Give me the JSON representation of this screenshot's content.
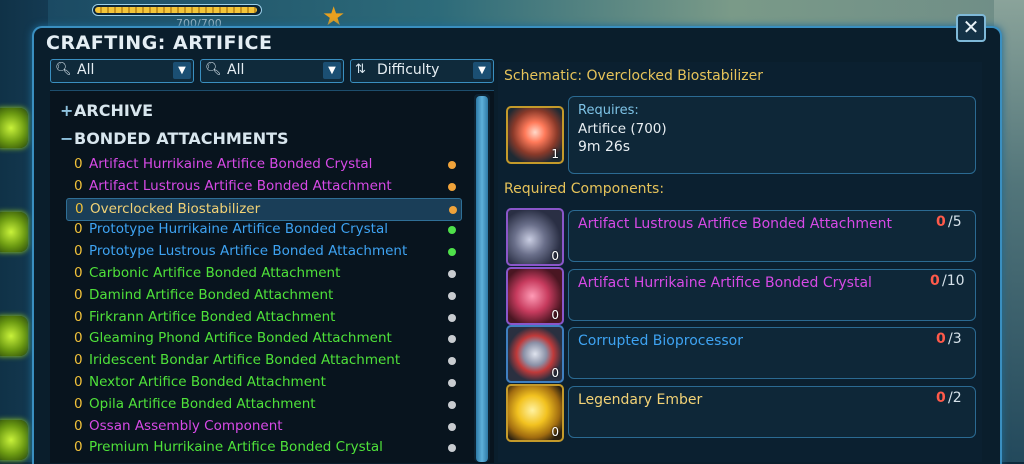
{
  "window": {
    "title": "CRAFTING: ARTIFICE"
  },
  "background": {
    "resource_bar_value": "700/700",
    "progress": 1.0
  },
  "filters": [
    {
      "label": "All",
      "icon": "search-icon"
    },
    {
      "label": "All",
      "icon": "search-icon"
    },
    {
      "label": "Difficulty",
      "icon": "sort-icon"
    }
  ],
  "categories": [
    {
      "symbol": "+",
      "label": "ARCHIVE"
    },
    {
      "symbol": "−",
      "label": "BONDED ATTACHMENTS"
    }
  ],
  "recipes": [
    {
      "count": "0",
      "name": "Artifact Hurrikaine Artifice Bonded Crystal",
      "color": "#d74ae6",
      "dot": "#f0a33a",
      "selected": false
    },
    {
      "count": "0",
      "name": "Artifact Lustrous Artifice Bonded Attachment",
      "color": "#d74ae6",
      "dot": "#f0a33a",
      "selected": false
    },
    {
      "count": "0",
      "name": "Overclocked Biostabilizer",
      "color": "#f2d276",
      "dot": "#f0a33a",
      "selected": true
    },
    {
      "count": "0",
      "name": "Prototype Hurrikaine Artifice Bonded Crystal",
      "color": "#3ea3f2",
      "dot": "#4ee04a",
      "selected": false
    },
    {
      "count": "0",
      "name": "Prototype Lustrous Artifice Bonded Attachment",
      "color": "#3ea3f2",
      "dot": "#4ee04a",
      "selected": false
    },
    {
      "count": "0",
      "name": "Carbonic Artifice Bonded Attachment",
      "color": "#4fe23a",
      "dot": "#c8ccd0",
      "selected": false
    },
    {
      "count": "0",
      "name": "Damind Artifice Bonded Attachment",
      "color": "#4fe23a",
      "dot": "#c8ccd0",
      "selected": false
    },
    {
      "count": "0",
      "name": "Firkrann Artifice Bonded Attachment",
      "color": "#4fe23a",
      "dot": "#c8ccd0",
      "selected": false
    },
    {
      "count": "0",
      "name": "Gleaming Phond Artifice Bonded Attachment",
      "color": "#4fe23a",
      "dot": "#c8ccd0",
      "selected": false
    },
    {
      "count": "0",
      "name": "Iridescent Bondar Artifice Bonded Attachment",
      "color": "#4fe23a",
      "dot": "#c8ccd0",
      "selected": false
    },
    {
      "count": "0",
      "name": "Nextor Artifice Bonded Attachment",
      "color": "#4fe23a",
      "dot": "#c8ccd0",
      "selected": false
    },
    {
      "count": "0",
      "name": "Opila Artifice Bonded Attachment",
      "color": "#4fe23a",
      "dot": "#c8ccd0",
      "selected": false
    },
    {
      "count": "0",
      "name": "Ossan Assembly Component",
      "color": "#d74ae6",
      "dot": "#c8ccd0",
      "selected": false
    },
    {
      "count": "0",
      "name": "Premium Hurrikaine Artifice Bonded Crystal",
      "color": "#4fe23a",
      "dot": "#c8ccd0",
      "selected": false
    }
  ],
  "schematic": {
    "label": "Schematic: Overclocked Biostabilizer",
    "icon_qty": "1",
    "requires_label": "Requires:",
    "skill": "Artifice (700)",
    "time": "9m 26s"
  },
  "components_heading": "Required Components:",
  "components": [
    {
      "name": "Artifact Lustrous Artifice Bonded Attachment",
      "color": "#d74ae6",
      "have": "0",
      "need": "/5",
      "qty": "0",
      "icon": "bonded-attachment-icon",
      "border": "#8a56c9"
    },
    {
      "name": "Artifact Hurrikaine Artifice Bonded Crystal",
      "color": "#d74ae6",
      "have": "0",
      "need": "/10",
      "qty": "0",
      "icon": "bonded-crystal-icon",
      "border": "#8a56c9"
    },
    {
      "name": "Corrupted Bioprocessor",
      "color": "#3ea3f2",
      "have": "0",
      "need": "/3",
      "qty": "0",
      "icon": "bioprocessor-icon",
      "border": "#3f7fc0"
    },
    {
      "name": "Legendary Ember",
      "color": "#f2d276",
      "have": "0",
      "need": "/2",
      "qty": "0",
      "icon": "ember-icon",
      "border": "#c49a2a"
    }
  ]
}
